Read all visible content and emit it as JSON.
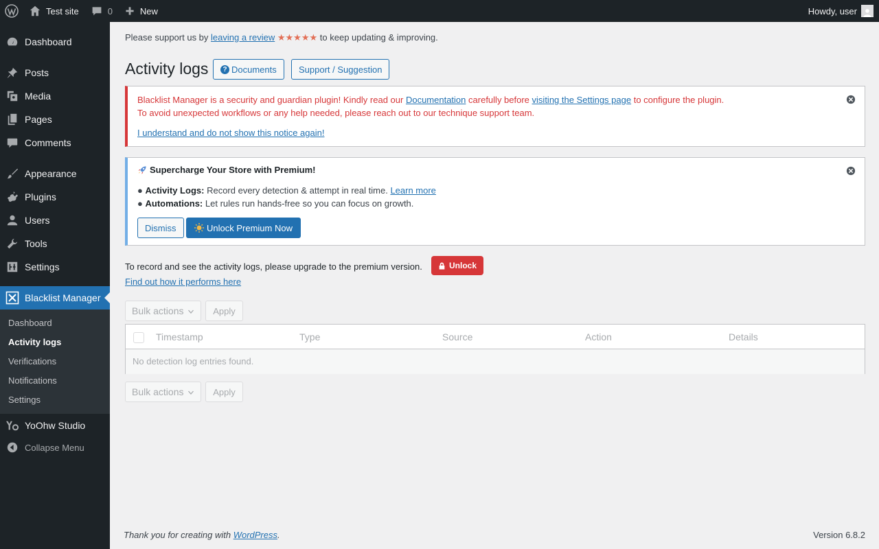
{
  "adminbar": {
    "site_name": "Test site",
    "comments_count": "0",
    "new_label": "New",
    "howdy": "Howdy, user"
  },
  "sidebar": {
    "items": [
      {
        "label": "Dashboard",
        "icon": "dashboard-icon"
      },
      {
        "label": "Posts",
        "icon": "pin-icon"
      },
      {
        "label": "Media",
        "icon": "media-icon"
      },
      {
        "label": "Pages",
        "icon": "pages-icon"
      },
      {
        "label": "Comments",
        "icon": "comment-icon"
      },
      {
        "label": "Appearance",
        "icon": "brush-icon"
      },
      {
        "label": "Plugins",
        "icon": "plug-icon"
      },
      {
        "label": "Users",
        "icon": "user-icon"
      },
      {
        "label": "Tools",
        "icon": "wrench-icon"
      },
      {
        "label": "Settings",
        "icon": "settings-icon"
      },
      {
        "label": "Blacklist Manager",
        "icon": "blacklist-icon"
      },
      {
        "label": "YoOhw Studio",
        "icon": "yoohw-icon"
      }
    ],
    "submenu": [
      "Dashboard",
      "Activity logs",
      "Verifications",
      "Notifications",
      "Settings"
    ],
    "collapse_label": "Collapse Menu"
  },
  "support": {
    "prefix": "Please support us by",
    "link": "leaving a review",
    "stars": "★★★★★",
    "suffix": "to keep updating & improving."
  },
  "page": {
    "title": "Activity logs",
    "documents_label": "Documents",
    "support_label": "Support / Suggestion"
  },
  "error_notice": {
    "line1_a": "Blacklist Manager is a security and guardian plugin! Kindly read our",
    "line1_link1": "Documentation",
    "line1_b": "carefully before",
    "line1_link2": "visiting the Settings page",
    "line1_c": "to configure the plugin.",
    "line2": "To avoid unexpected workflows or any help needed, please reach out to our technique support team.",
    "dismiss_link": "I understand and do not show this notice again!"
  },
  "premium_notice": {
    "title": "Supercharge Your Store with Premium!",
    "items": [
      {
        "bullet": "●",
        "bold": "Activity Logs:",
        "text": "Record every detection & attempt in real time.",
        "link": "Learn more"
      },
      {
        "bullet": "●",
        "bold": "Automations:",
        "text": "Let rules run hands-free so you can focus on growth.",
        "link": ""
      }
    ],
    "dismiss_label": "Dismiss",
    "unlock_label": "Unlock Premium Now"
  },
  "upgrade": {
    "text": "To record and see the activity logs, please upgrade to the premium version.",
    "unlock_label": "Unlock",
    "find_link": "Find out how it performs here"
  },
  "bulk": {
    "select_label": "Bulk actions",
    "apply_label": "Apply"
  },
  "table": {
    "columns": [
      "Timestamp",
      "Type",
      "Source",
      "Action",
      "Details"
    ],
    "empty_message": "No detection log entries found."
  },
  "footer": {
    "thanks_prefix": "Thank you for creating with",
    "thanks_link": "WordPress",
    "thanks_suffix": ".",
    "version": "Version 6.8.2"
  },
  "colors": {
    "adminbar_bg": "#1d2327",
    "accent": "#2271b1",
    "error": "#d63638",
    "info": "#72aee6",
    "stars": "#e26f56"
  }
}
